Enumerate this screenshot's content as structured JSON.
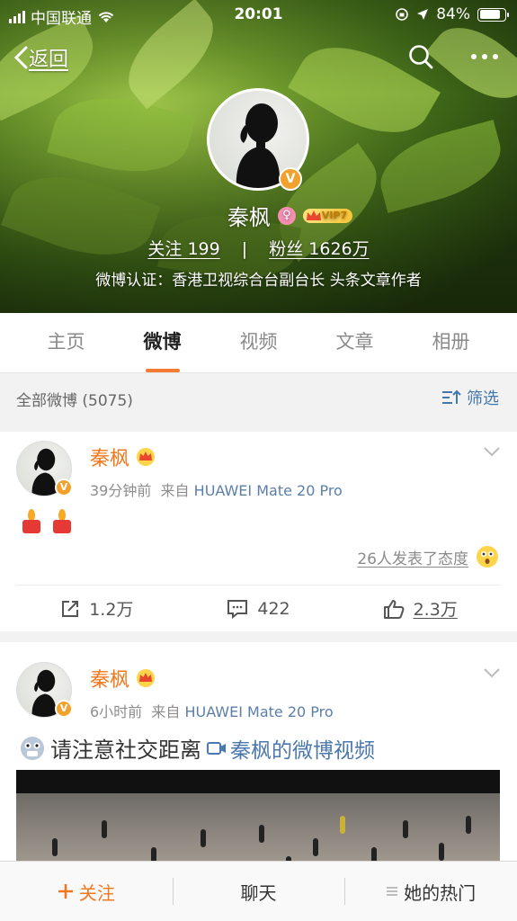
{
  "status_bar": {
    "carrier": "中国联通",
    "time": "20:01",
    "battery": "84%"
  },
  "nav": {
    "back_label": "返回"
  },
  "profile": {
    "name": "秦枫",
    "vip_label": "VIP7",
    "following_label": "关注",
    "following_count": "199",
    "followers_label": "粉丝",
    "followers_count": "1626万",
    "verification": "微博认证：香港卫视综合台副台长 头条文章作者"
  },
  "tabs": [
    {
      "label": "主页"
    },
    {
      "label": "微博"
    },
    {
      "label": "视频"
    },
    {
      "label": "文章"
    },
    {
      "label": "相册"
    }
  ],
  "filter_bar": {
    "count_label": "全部微博 (5075)",
    "filter_label": "筛选"
  },
  "posts": [
    {
      "author": "秦枫",
      "time": "39分钟前",
      "source_prefix": "来自",
      "source": "HUAWEI Mate 20 Pro",
      "reactions": "26人发表了态度",
      "repost_count": "1.2万",
      "comment_count": "422",
      "like_count": "2.3万"
    },
    {
      "author": "秦枫",
      "time": "6小时前",
      "source_prefix": "来自",
      "source": "HUAWEI Mate 20 Pro",
      "text": "请注意社交距离",
      "video_link": "秦枫的微博视频"
    }
  ],
  "bottom_bar": {
    "follow_label": "关注",
    "chat_label": "聊天",
    "hot_label": "她的热门"
  },
  "colors": {
    "accent_orange": "#f2781e",
    "link_blue": "#4b78ad",
    "vip_gold": "#f8c53a"
  }
}
